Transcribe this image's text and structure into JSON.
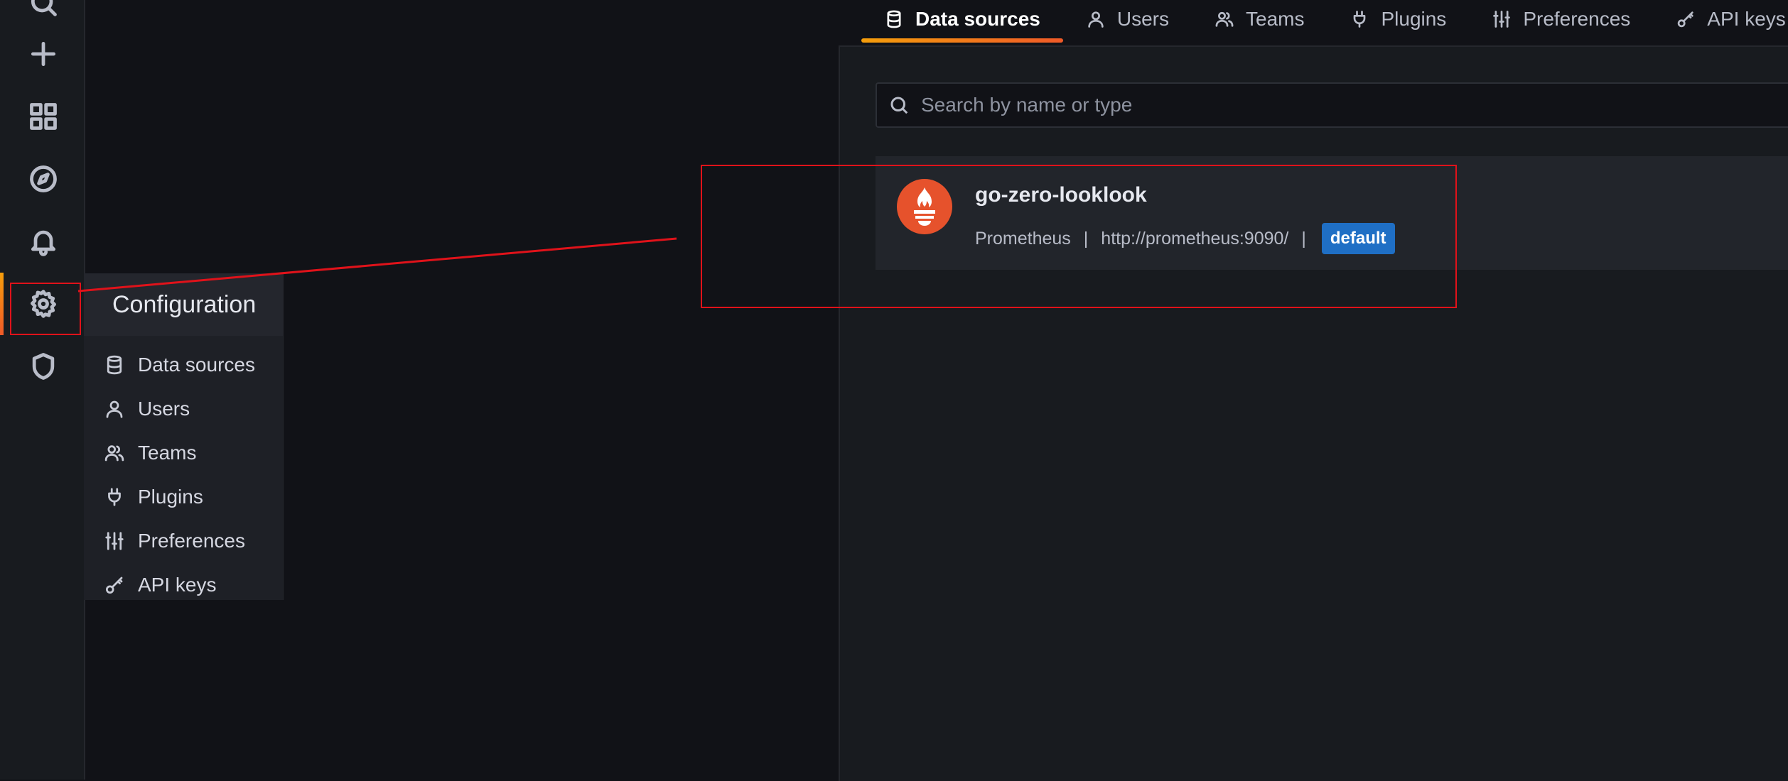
{
  "rail": {
    "icons": [
      "search-icon",
      "plus-icon",
      "dashboards-icon",
      "explore-icon",
      "alerting-icon",
      "gear-icon",
      "shield-icon"
    ]
  },
  "flyout": {
    "title": "Configuration",
    "items": [
      {
        "label": "Data sources",
        "icon": "database-icon"
      },
      {
        "label": "Users",
        "icon": "user-icon"
      },
      {
        "label": "Teams",
        "icon": "teams-icon"
      },
      {
        "label": "Plugins",
        "icon": "plug-icon"
      },
      {
        "label": "Preferences",
        "icon": "sliders-icon"
      },
      {
        "label": "API keys",
        "icon": "key-icon"
      }
    ]
  },
  "tabs": [
    {
      "label": "Data sources",
      "icon": "database-icon",
      "active": true
    },
    {
      "label": "Users",
      "icon": "user-icon"
    },
    {
      "label": "Teams",
      "icon": "teams-icon"
    },
    {
      "label": "Plugins",
      "icon": "plug-icon"
    },
    {
      "label": "Preferences",
      "icon": "sliders-icon"
    },
    {
      "label": "API keys",
      "icon": "key-icon"
    }
  ],
  "search": {
    "placeholder": "Search by name or type"
  },
  "datasource": {
    "name": "go-zero-looklook",
    "type": "Prometheus",
    "separator": "|",
    "url": "http://prometheus:9090/",
    "badge": "default"
  },
  "colors": {
    "accent": "#f05a28",
    "badge": "#1f6fc5",
    "annotation": "#e0121a",
    "prometheus": "#e6522c"
  }
}
